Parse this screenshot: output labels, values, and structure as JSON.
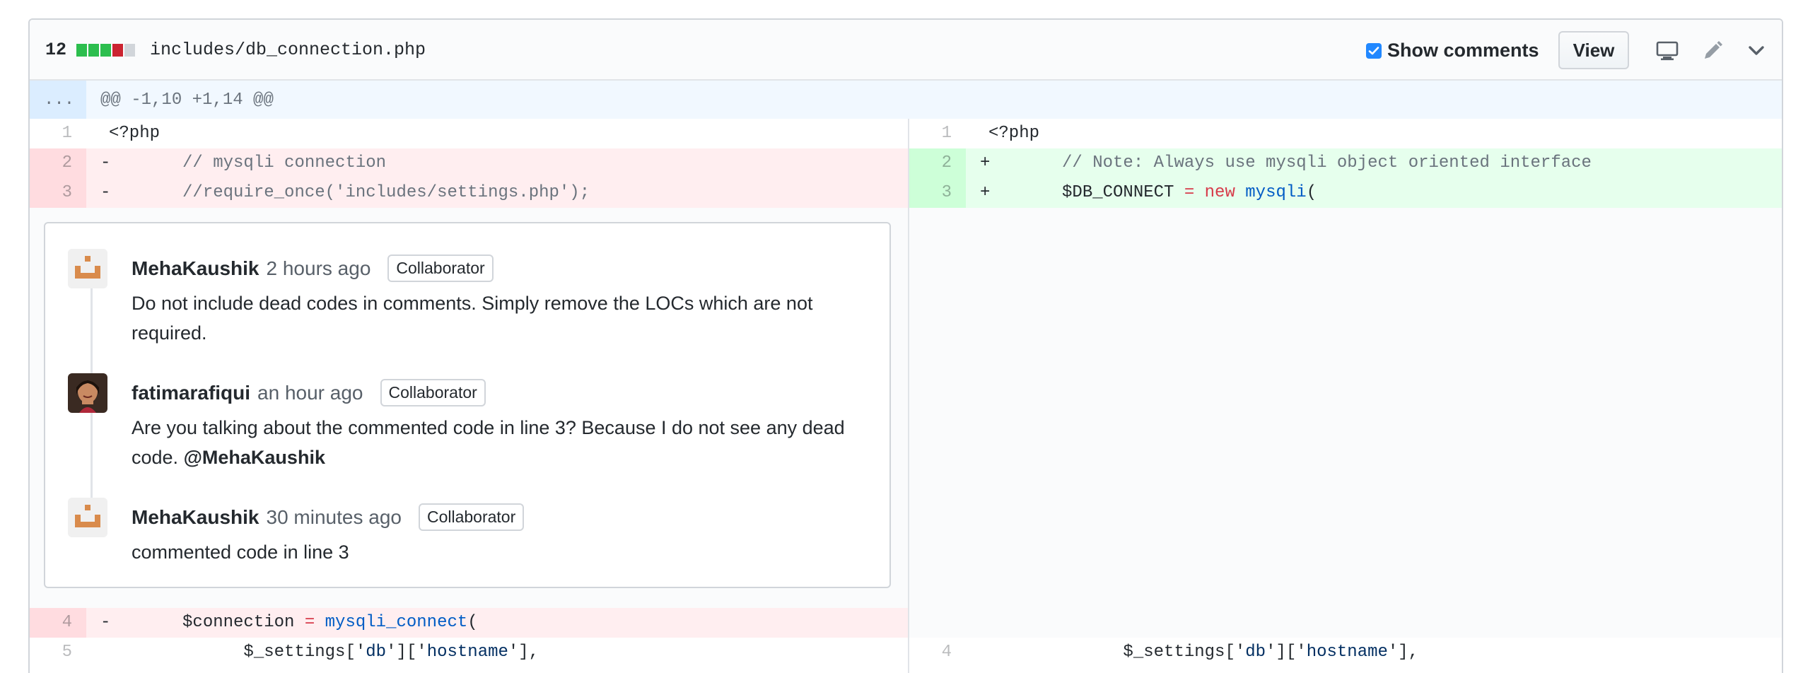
{
  "file": {
    "changes": "12",
    "path": "includes/db_connection.php",
    "diffstat_colors": [
      "#2cbe4e",
      "#2cbe4e",
      "#2cbe4e",
      "#cb2431",
      "#d1d5da"
    ],
    "show_comments_label": "Show comments",
    "show_comments_checked": true,
    "view_label": "View",
    "icons": [
      "desktop-icon",
      "pencil-icon",
      "chevron-down-icon"
    ]
  },
  "hunk": {
    "dots": "...",
    "header": "@@ -1,10 +1,14 @@"
  },
  "left_lines": [
    {
      "num": "1",
      "sign": "",
      "code": "<?php",
      "type": "context"
    },
    {
      "num": "2",
      "sign": "-",
      "code": "     // mysqli connection",
      "type": "del"
    },
    {
      "num": "3",
      "sign": "-",
      "code": "     //require_once('includes/settings.php');",
      "type": "del"
    },
    {
      "num": "4",
      "sign": "-",
      "code": "     $connection = mysqli_connect(",
      "type": "del"
    },
    {
      "num": "5",
      "sign": "",
      "code": "           $_settings['db']['hostname'],",
      "type": "context"
    }
  ],
  "right_lines": [
    {
      "num": "1",
      "sign": "",
      "code": "<?php",
      "type": "context"
    },
    {
      "num": "2",
      "sign": "+",
      "code": "     // Note: Always use mysqli object oriented interface",
      "type": "add"
    },
    {
      "num": "3",
      "sign": "+",
      "code": "     $DB_CONNECT = new mysqli(",
      "type": "add"
    },
    {
      "num": "4",
      "sign": "",
      "code": "           $_settings['db']['hostname'],",
      "type": "context"
    }
  ],
  "comments": [
    {
      "author": "MehaKaushik",
      "time": "2 hours ago",
      "badge": "Collaborator",
      "body": "Do not include dead codes in comments. Simply remove the LOCs which are not required."
    },
    {
      "author": "fatimarafiqui",
      "time": "an hour ago",
      "badge": "Collaborator",
      "body": "Are you talking about the commented code in line 3? Because I do not see any dead code.",
      "mention": "@MehaKaushik"
    },
    {
      "author": "MehaKaushik",
      "time": "30 minutes ago",
      "badge": "Collaborator",
      "body": "commented code in line 3"
    }
  ]
}
